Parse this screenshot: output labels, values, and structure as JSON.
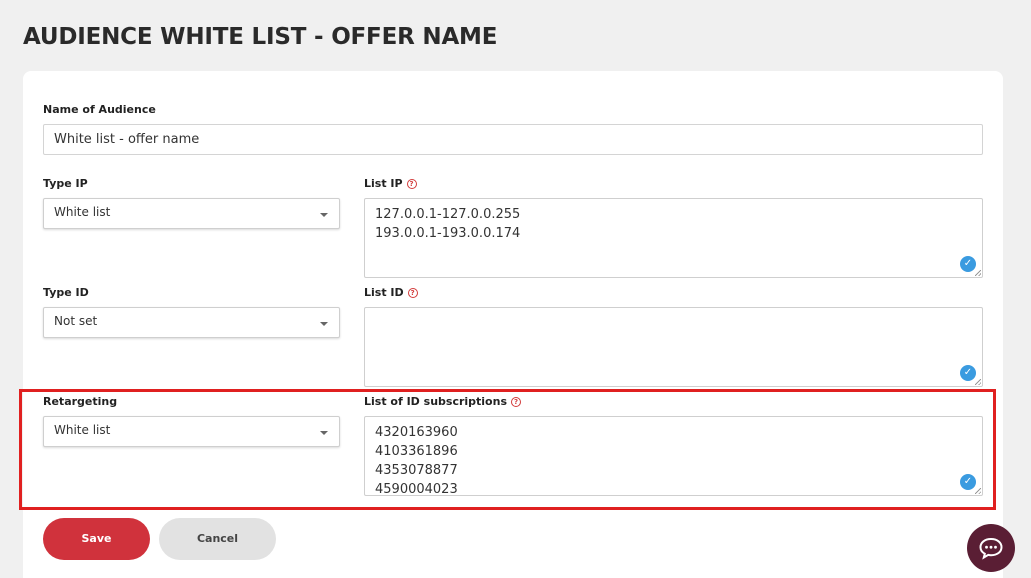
{
  "page": {
    "title": "AUDIENCE WHITE LIST - OFFER NAME"
  },
  "form": {
    "name_label": "Name of Audience",
    "name_value": "White list - offer name",
    "type_ip_label": "Type IP",
    "type_ip_value": "White list",
    "list_ip_label": "List IP",
    "list_ip_lines": [
      "127.0.0.1-127.0.0.255",
      "193.0.0.1-193.0.0.174"
    ],
    "type_id_label": "Type ID",
    "type_id_value": "Not set",
    "list_id_label": "List ID",
    "retargeting_label": "Retargeting",
    "retargeting_value": "White list",
    "subscriptions_label": "List of ID subscriptions",
    "subscriptions_lines": [
      "4320163960",
      "4103361896",
      "4353078877",
      "4590004023"
    ],
    "help_glyph": "?",
    "check_glyph": "✓"
  },
  "actions": {
    "save_label": "Save",
    "cancel_label": "Cancel"
  },
  "colors": {
    "accent": "#d0323c",
    "highlight": "#e02020",
    "chat": "#5a1e34",
    "check": "#3a9be0"
  },
  "icons": {
    "help": "help-icon",
    "check": "check-circle-icon",
    "chat": "chat-icon",
    "caret": "chevron-down-icon"
  }
}
